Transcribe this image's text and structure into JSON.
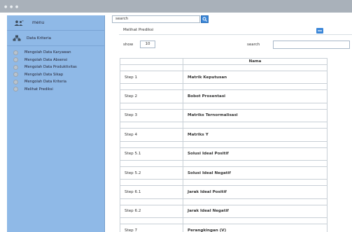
{
  "sidebar": {
    "menu_label": "menu",
    "section_label": "Data Kriteria",
    "items": [
      {
        "label": "Mengolah Data Karyawan"
      },
      {
        "label": "Mengolah Data Absensi"
      },
      {
        "label": "Mengolah Data Produktivitas"
      },
      {
        "label": "Mengolah Data Sikap"
      },
      {
        "label": "Mengolah Data Kriteria"
      },
      {
        "label": "Melihat Prediksi"
      }
    ]
  },
  "search_top": {
    "value": "search"
  },
  "main": {
    "dropdown_label": "Melihat Prediksi",
    "show_label": "show",
    "show_value": "10",
    "search_label": "search",
    "table": {
      "headers": [
        "",
        "Nama"
      ],
      "rows": [
        {
          "step": "Step 1",
          "name": "Matrik Keputusan"
        },
        {
          "step": "Step 2",
          "name": "Bobot Prosentasi"
        },
        {
          "step": "Step 3",
          "name": "Matriks Ternormalisasi"
        },
        {
          "step": "Step 4",
          "name": "Matriks Y"
        },
        {
          "step": "Step 5.1",
          "name": "Solusi Ideal Positif"
        },
        {
          "step": "Step 5.2",
          "name": "Solusi Ideal Negatif"
        },
        {
          "step": "Step 6.1",
          "name": "Jarak Ideal Positif"
        },
        {
          "step": "Step 6.2",
          "name": "Jarak Ideal Negatif"
        },
        {
          "step": "Step 7",
          "name": "Perangkingan (V)"
        }
      ]
    }
  }
}
